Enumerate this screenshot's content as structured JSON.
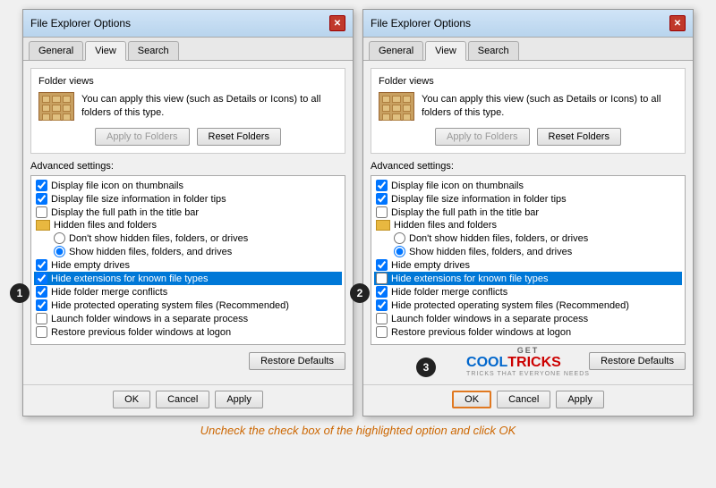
{
  "dialogs": [
    {
      "title": "File Explorer Options",
      "tabs": [
        "General",
        "View",
        "Search"
      ],
      "active_tab": "View",
      "folder_views_label": "Folder views",
      "folder_desc": "You can apply this view (such as Details or Icons) to all folders of this type.",
      "apply_btn": "Apply to Folders",
      "reset_btn": "Reset Folders",
      "advanced_label": "Advanced settings:",
      "settings": [
        {
          "type": "checkbox",
          "checked": true,
          "label": "Display file icon on thumbnails",
          "highlighted": false
        },
        {
          "type": "checkbox",
          "checked": true,
          "label": "Display file size information in folder tips",
          "highlighted": false
        },
        {
          "type": "checkbox",
          "checked": false,
          "label": "Display the full path in the title bar",
          "highlighted": false
        },
        {
          "type": "group",
          "label": "Hidden files and folders"
        },
        {
          "type": "radio",
          "checked": false,
          "label": "Don't show hidden files, folders, or drives",
          "highlighted": false
        },
        {
          "type": "radio",
          "checked": true,
          "label": "Show hidden files, folders, and drives",
          "highlighted": false
        },
        {
          "type": "checkbox",
          "checked": true,
          "label": "Hide empty drives",
          "highlighted": false
        },
        {
          "type": "checkbox",
          "checked": true,
          "label": "Hide extensions for known file types",
          "highlighted": true
        },
        {
          "type": "checkbox",
          "checked": true,
          "label": "Hide folder merge conflicts",
          "highlighted": false
        },
        {
          "type": "checkbox",
          "checked": true,
          "label": "Hide protected operating system files (Recommended)",
          "highlighted": false
        },
        {
          "type": "checkbox",
          "checked": false,
          "label": "Launch folder windows in a separate process",
          "highlighted": false
        },
        {
          "type": "checkbox",
          "checked": false,
          "label": "Restore previous folder windows at logon",
          "highlighted": false
        }
      ],
      "restore_btn": "Restore Defaults",
      "footer_btns": [
        "OK",
        "Cancel",
        "Apply"
      ],
      "badge": "1",
      "ok_highlight": false
    },
    {
      "title": "File Explorer Options",
      "tabs": [
        "General",
        "View",
        "Search"
      ],
      "active_tab": "View",
      "folder_views_label": "Folder views",
      "folder_desc": "You can apply this view (such as Details or Icons) to all folders of this type.",
      "apply_btn": "Apply to Folders",
      "reset_btn": "Reset Folders",
      "advanced_label": "Advanced settings:",
      "settings": [
        {
          "type": "checkbox",
          "checked": true,
          "label": "Display file icon on thumbnails",
          "highlighted": false
        },
        {
          "type": "checkbox",
          "checked": true,
          "label": "Display file size information in folder tips",
          "highlighted": false
        },
        {
          "type": "checkbox",
          "checked": false,
          "label": "Display the full path in the title bar",
          "highlighted": false
        },
        {
          "type": "group",
          "label": "Hidden files and folders"
        },
        {
          "type": "radio",
          "checked": false,
          "label": "Don't show hidden files, folders, or drives",
          "highlighted": false
        },
        {
          "type": "radio",
          "checked": true,
          "label": "Show hidden files, folders, and drives",
          "highlighted": false
        },
        {
          "type": "checkbox",
          "checked": true,
          "label": "Hide empty drives",
          "highlighted": false
        },
        {
          "type": "checkbox",
          "checked": false,
          "label": "Hide extensions for known file types",
          "highlighted": true
        },
        {
          "type": "checkbox",
          "checked": true,
          "label": "Hide folder merge conflicts",
          "highlighted": false
        },
        {
          "type": "checkbox",
          "checked": true,
          "label": "Hide protected operating system files (Recommended)",
          "highlighted": false
        },
        {
          "type": "checkbox",
          "checked": false,
          "label": "Launch folder windows in a separate process",
          "highlighted": false
        },
        {
          "type": "checkbox",
          "checked": false,
          "label": "Restore previous folder windows at logon",
          "highlighted": false
        }
      ],
      "restore_btn": "Restore Defaults",
      "footer_btns": [
        "OK",
        "Cancel",
        "Apply"
      ],
      "badge": "2",
      "ok_highlight": true
    }
  ],
  "badge3": "3",
  "logo": {
    "get": "GET",
    "cool": "COOL",
    "tricks": "TRICKS",
    "sub": "TRICKS THAT EVERYONE NEEDS"
  },
  "caption": "Uncheck the check box of the highlighted option and click OK"
}
